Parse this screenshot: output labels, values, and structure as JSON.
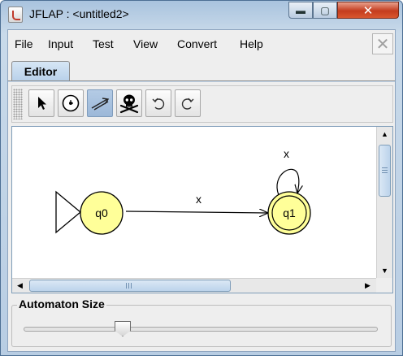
{
  "window": {
    "title": "JFLAP : <untitled2>",
    "buttons": {
      "minimize": "▬",
      "maximize": "▢",
      "close": "✕"
    }
  },
  "menubar": {
    "items": [
      "File",
      "Input",
      "Test",
      "View",
      "Convert",
      "Help"
    ],
    "close_glyph": "✕"
  },
  "tabs": [
    {
      "label": "Editor",
      "selected": true
    }
  ],
  "toolbar": {
    "tools": [
      {
        "name": "attribute-editor",
        "icon": "arrow-pointer-icon",
        "active": false
      },
      {
        "name": "state-creator",
        "icon": "state-circle-icon",
        "active": false
      },
      {
        "name": "transition-creator",
        "icon": "transition-arrow-icon",
        "active": true
      },
      {
        "name": "deleter",
        "icon": "skull-crossbones-icon",
        "active": false
      },
      {
        "name": "undo",
        "icon": "undo-icon",
        "active": false
      },
      {
        "name": "redo",
        "icon": "redo-icon",
        "active": false
      }
    ]
  },
  "automaton": {
    "states": [
      {
        "id": "q0",
        "label": "q0",
        "initial": true,
        "final": false
      },
      {
        "id": "q1",
        "label": "q1",
        "initial": false,
        "final": true
      }
    ],
    "transitions": [
      {
        "from": "q0",
        "to": "q1",
        "label": "x"
      },
      {
        "from": "q1",
        "to": "q1",
        "label": "x"
      }
    ],
    "state_fill": "#ffff99",
    "state_stroke": "#000000"
  },
  "scrollbars": {
    "up": "▲",
    "down": "▼",
    "left": "◀",
    "right": "▶"
  },
  "automaton_size": {
    "label": "Automaton Size",
    "value": 0.28
  },
  "colors": {
    "titlebar": "#b8cde3",
    "close_button": "#c43c1e",
    "tab_selected": "#b9d1ea",
    "active_tool": "#9cb8d8"
  }
}
